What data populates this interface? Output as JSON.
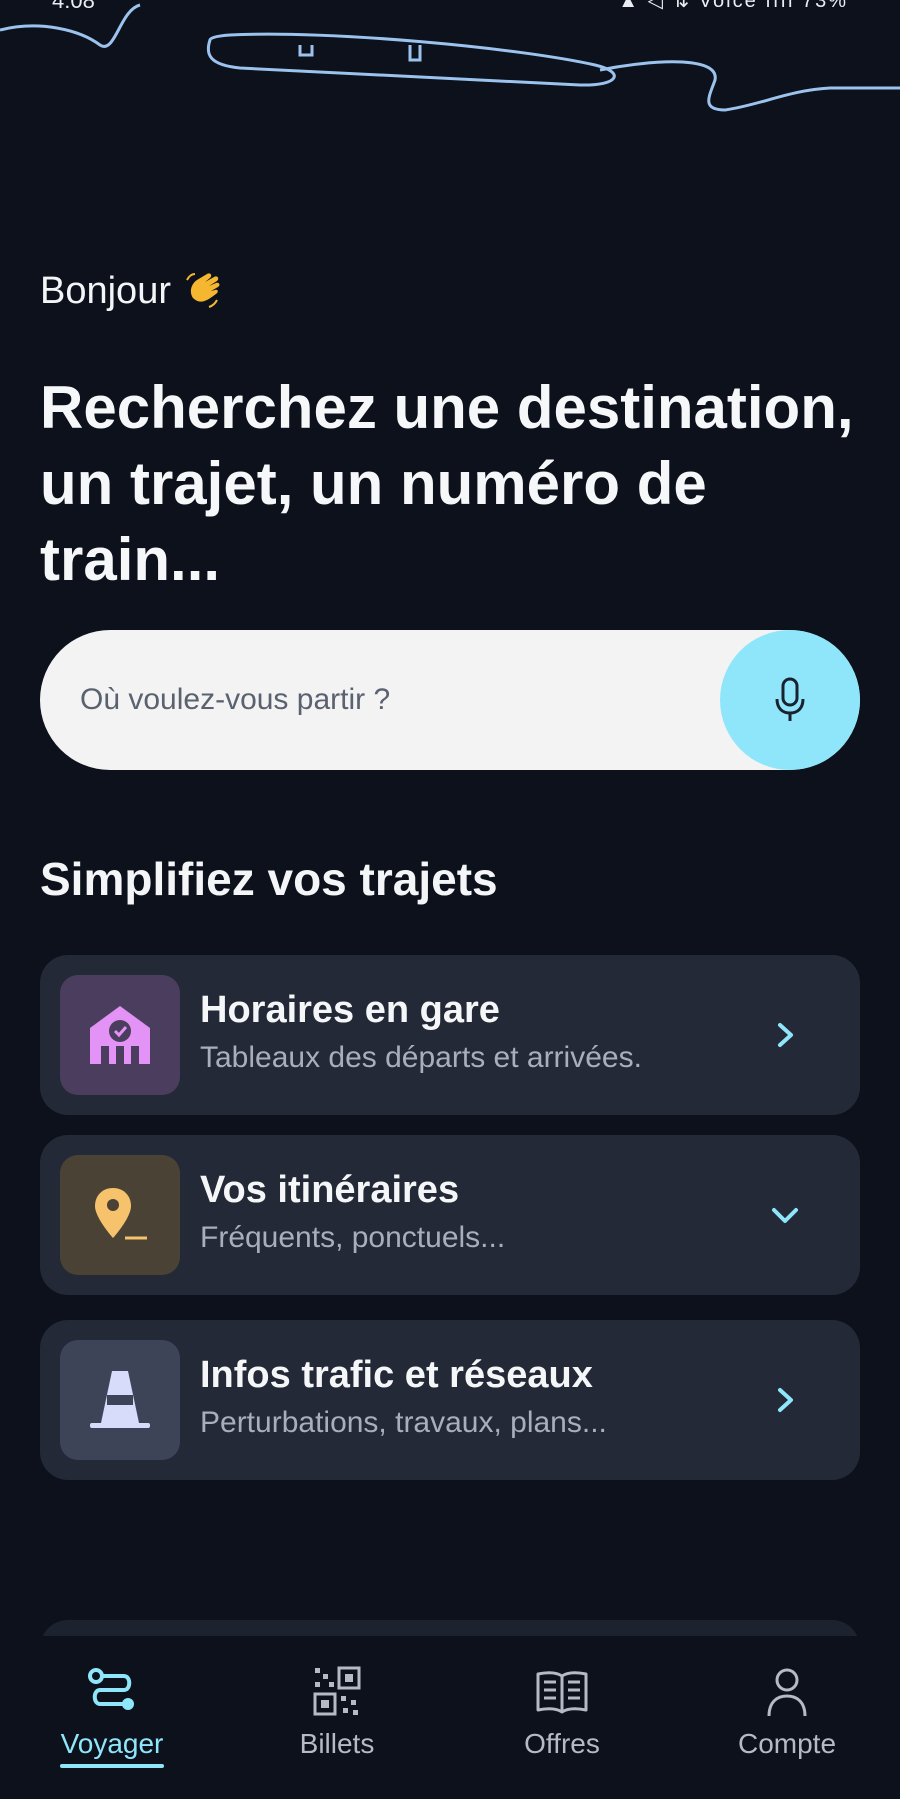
{
  "status_bar": {
    "time": "4:08",
    "right": "▲ ◁ ⇅ Voice ıııl 73%"
  },
  "greeting": {
    "text": "Bonjour",
    "emoji_icon": "waving-hand-icon"
  },
  "headline": "Recherchez une destination, un trajet, un numéro de train...",
  "search": {
    "placeholder": "Où voulez-vous partir ?",
    "mic_icon": "microphone-icon"
  },
  "section_title": "Simplifiez vos trajets",
  "cards": [
    {
      "title": "Horaires en gare",
      "subtitle": "Tableaux des départs et arrivées.",
      "icon": "station-check-icon",
      "action_icon": "chevron-right-icon",
      "tile_color": "#4a3d5e",
      "icon_color": "#e293f5"
    },
    {
      "title": "Vos itinéraires",
      "subtitle": "Fréquents, ponctuels...",
      "icon": "location-pin-icon",
      "action_icon": "chevron-down-icon",
      "tile_color": "#4b4236",
      "icon_color": "#f6c26b"
    },
    {
      "title": "Infos trafic et réseaux",
      "subtitle": "Perturbations, travaux, plans...",
      "icon": "traffic-cone-icon",
      "action_icon": "chevron-right-icon",
      "tile_color": "#3e4458",
      "icon_color": "#d7dcfb"
    }
  ],
  "bottom_nav": [
    {
      "label": "Voyager",
      "icon": "route-icon",
      "active": true
    },
    {
      "label": "Billets",
      "icon": "qr-code-icon",
      "active": false
    },
    {
      "label": "Offres",
      "icon": "open-book-icon",
      "active": false
    },
    {
      "label": "Compte",
      "icon": "user-icon",
      "active": false
    }
  ],
  "colors": {
    "background": "#0c111c",
    "accent": "#8fe6fb",
    "card": "#232936",
    "search_bg": "#f3f3f3"
  }
}
